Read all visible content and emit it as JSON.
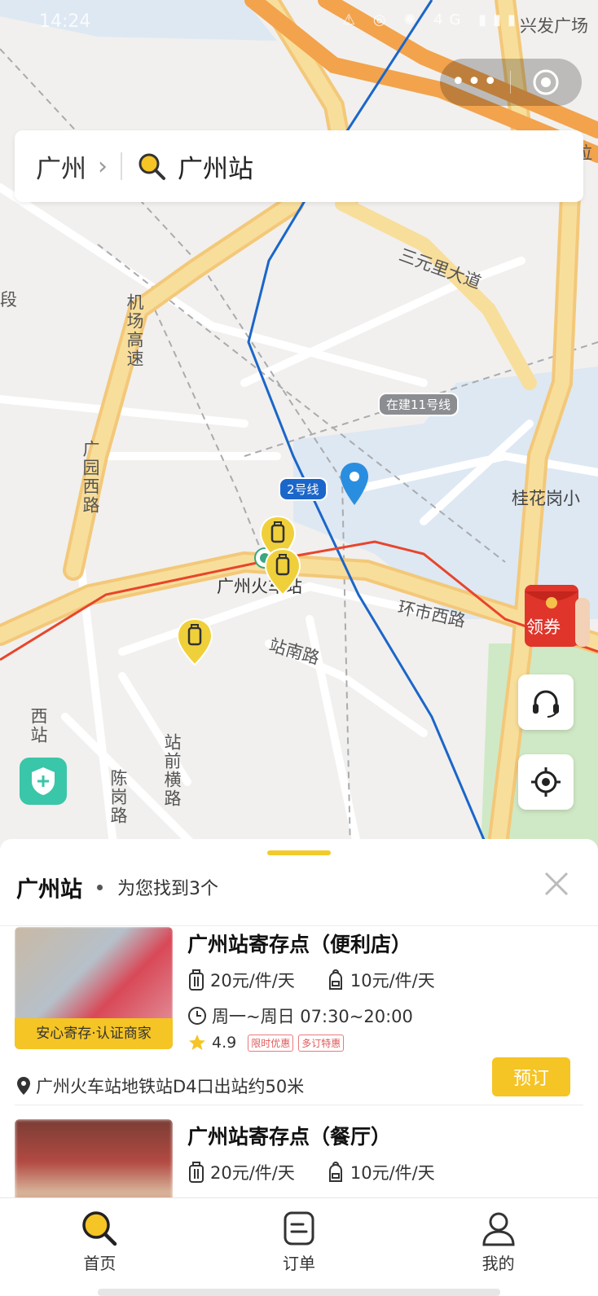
{
  "status": {
    "time": "14:24",
    "icons": "⚠ ◎ ✺ 4G ▮▮▮"
  },
  "capsule": {
    "more_label": "•••"
  },
  "search": {
    "city": "广州",
    "chevron": "›",
    "query": "广州站"
  },
  "map": {
    "labels": {
      "sanyuanli": "三元里大道",
      "jichang": "机场高速",
      "guangyuan": "广园西路",
      "huanshi": "环市西路",
      "zhannan": "站南路",
      "zhanqian": "站前横路",
      "chengang": "陈岗路",
      "xizhan": "西站",
      "guihuagang": "桂花岗小",
      "station": "广州火车站",
      "xingfa": "兴发广场",
      "la": "拉",
      "duan": "段"
    },
    "line2_badge": "2号线",
    "line11_badge": "在建11号线",
    "red_packet_label": "领券"
  },
  "sheet": {
    "title": "广州站",
    "count": "为您找到3个",
    "items": [
      {
        "name": "广州站寄存点（便利店）",
        "badge": "安心寄存·认证商家",
        "price_large": "20元/件/天",
        "price_small": "10元/件/天",
        "hours": "周一~周日 07:30~20:00",
        "rating": "4.9",
        "tag1": "限时优惠",
        "tag2": "多订特惠",
        "address": "广州火车站地铁站D4口出站约50米",
        "book_label": "预订"
      },
      {
        "name": "广州站寄存点（餐厅）",
        "price_large": "20元/件/天",
        "price_small": "10元/件/天"
      }
    ]
  },
  "tabs": [
    {
      "label": "首页",
      "icon": "search-icon"
    },
    {
      "label": "订单",
      "icon": "order-icon"
    },
    {
      "label": "我的",
      "icon": "user-icon"
    }
  ],
  "colors": {
    "accent": "#f5c425",
    "line2": "#1b66c9",
    "mint": "#3ac6a8"
  }
}
